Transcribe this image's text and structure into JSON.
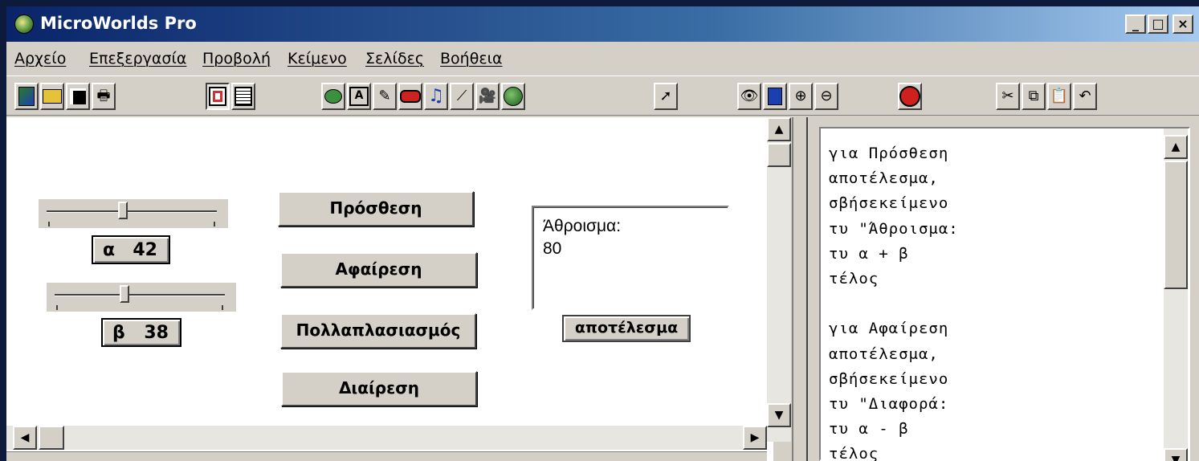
{
  "window": {
    "title": "MicroWorlds Pro"
  },
  "caption_buttons": {
    "minimize": "_",
    "maximize": "□",
    "close": "×"
  },
  "menu": [
    "Αρχείο",
    "Επεξεργασία",
    "Προβολή",
    "Κείμενο",
    "Σελίδες",
    "Βοήθεια"
  ],
  "toolbar_icons": [
    "new-project-icon",
    "open-folder-icon",
    "save-icon",
    "print-icon",
    "page-view-icon",
    "procedures-view-icon",
    "hatch-turtle-icon",
    "text-box-icon",
    "paint-icon",
    "button-icon",
    "music-icon",
    "slider-icon",
    "video-icon",
    "graphics-center-icon",
    "pointer-icon",
    "eye-icon",
    "stamp-icon",
    "zoom-in-icon",
    "zoom-out-icon",
    "stop-icon",
    "cut-icon",
    "copy-icon",
    "paste-icon",
    "undo-icon"
  ],
  "sliders": [
    {
      "name": "α",
      "value": "42",
      "level": 0.42
    },
    {
      "name": "β",
      "value": "38",
      "level": 0.38
    }
  ],
  "buttons": {
    "add": "Πρόσθεση",
    "subtract": "Αφαίρεση",
    "multiply": "Πολλαπλασιασμός",
    "divide": "Διαίρεση",
    "result": "αποτέλεσμα"
  },
  "text_box": {
    "content": "Άθροισμα:\n80"
  },
  "procedures": {
    "text": "για Πρόσθεση\nαποτέλεσμα,\nσβήσεκείμενο\nτυ \"Άθροισμα:\nτυ α + β\nτέλος\n\nγια Αφαίρεση\nαποτέλεσμα,\nσβήσεκείμενο\nτυ \"Διαφορά:\nτυ α - β\nτέλος"
  },
  "scroll_arrows": {
    "up": "▲",
    "down": "▼",
    "left": "◀",
    "right": "▶"
  }
}
